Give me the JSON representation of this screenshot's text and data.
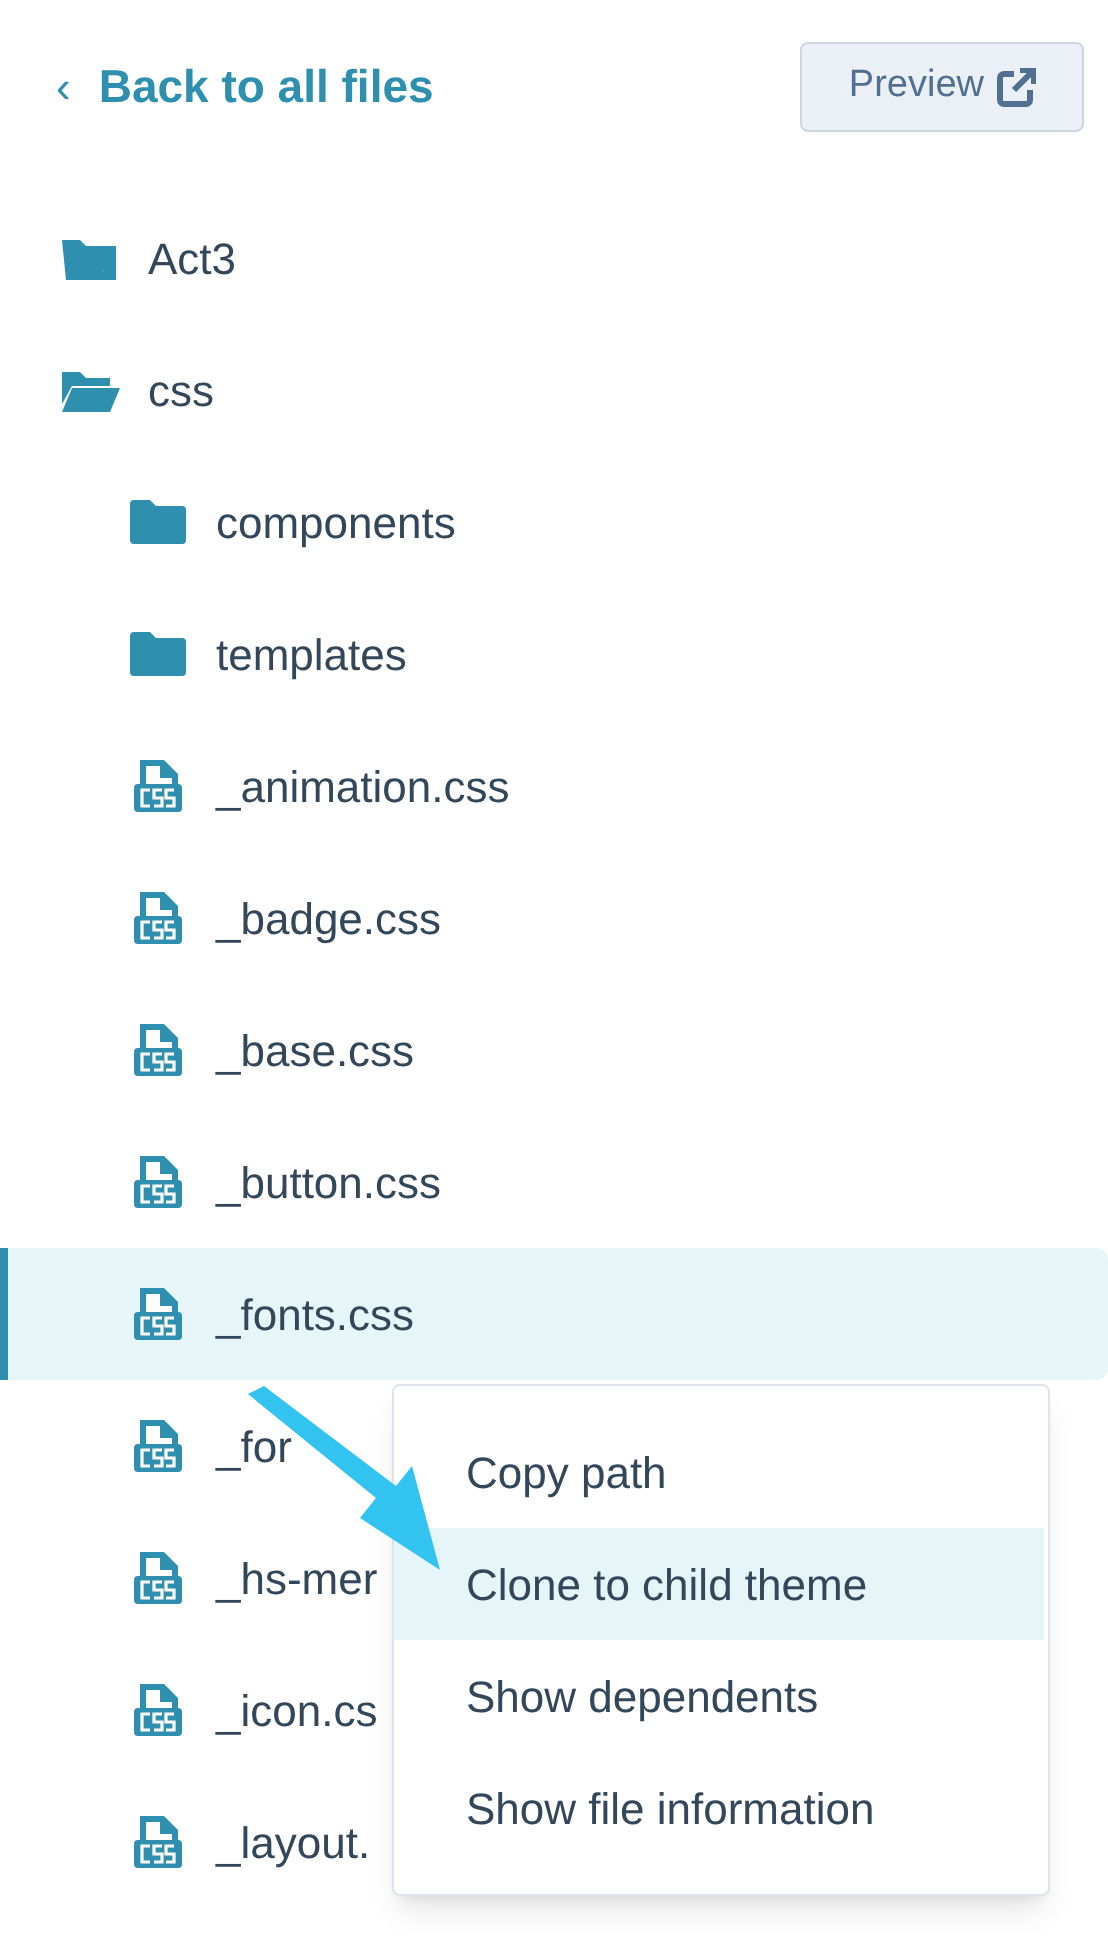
{
  "header": {
    "back_link": "Back to all files",
    "back_icon": "‹",
    "preview_button": "Preview"
  },
  "tree": [
    {
      "kind": "theme",
      "label": "Act3",
      "selected": false
    },
    {
      "kind": "folder",
      "label": "css",
      "expanded": true,
      "selected": false,
      "children": [
        {
          "kind": "folder",
          "label": "components",
          "selected": false
        },
        {
          "kind": "folder",
          "label": "templates",
          "selected": false
        },
        {
          "kind": "css",
          "label": "_animation.css",
          "selected": false
        },
        {
          "kind": "css",
          "label": "_badge.css",
          "selected": false
        },
        {
          "kind": "css",
          "label": "_base.css",
          "selected": false
        },
        {
          "kind": "css",
          "label": "_button.css",
          "selected": false
        },
        {
          "kind": "css",
          "label": "_fonts.css",
          "selected": true
        },
        {
          "kind": "css",
          "label": "_for",
          "selected": false
        },
        {
          "kind": "css",
          "label": "_hs-mer",
          "selected": false
        },
        {
          "kind": "css",
          "label": "_icon.cs",
          "selected": false
        },
        {
          "kind": "css",
          "label": "_layout.",
          "selected": false
        }
      ]
    }
  ],
  "context_menu": [
    {
      "label": "Copy path",
      "selected": false
    },
    {
      "label": "Clone to child theme",
      "selected": true
    },
    {
      "label": "Show dependents",
      "selected": false
    },
    {
      "label": "Show file information",
      "selected": false
    }
  ]
}
